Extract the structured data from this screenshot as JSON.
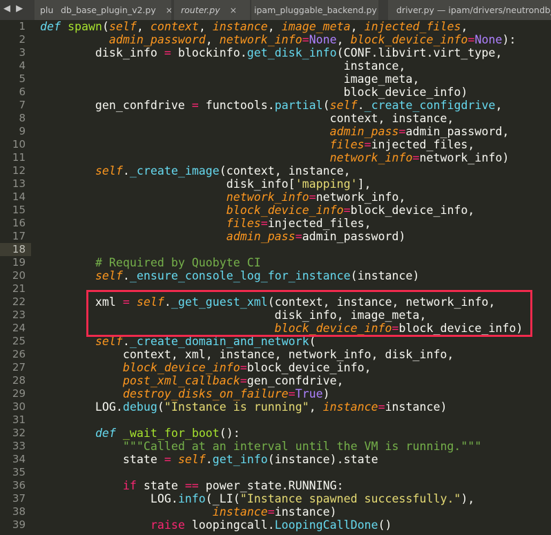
{
  "colors": {
    "background": "#272822",
    "highlight_box": "#ef2a4d",
    "keyword": "#66d9ef",
    "function": "#a6e22e",
    "parameter": "#fd971f",
    "operator": "#f92672",
    "constant": "#ae81ff",
    "string": "#e6db74",
    "comment": "#75b04a"
  },
  "tabs": [
    {
      "label": "plu",
      "close": ""
    },
    {
      "label": "db_base_plugin_v2.py",
      "close": "×"
    },
    {
      "label": "router.py",
      "close": "×"
    },
    {
      "label": "ipam_pluggable_backend.py",
      "close": "●"
    },
    {
      "label": "driver.py — ipam/drivers/neutrondb_ipam",
      "close": ""
    }
  ],
  "nav": "◀ ▶",
  "current_line": 18,
  "highlighted_lines": [
    22,
    24
  ],
  "lines": [
    [
      [
        "kw",
        "def"
      ],
      [
        "pl",
        " "
      ],
      [
        "fn",
        "spawn"
      ],
      [
        "pl",
        "("
      ],
      [
        "pa",
        "self"
      ],
      [
        "pl",
        ", "
      ],
      [
        "pa",
        "context"
      ],
      [
        "pl",
        ", "
      ],
      [
        "pa",
        "instance"
      ],
      [
        "pl",
        ", "
      ],
      [
        "pa",
        "image_meta"
      ],
      [
        "pl",
        ", "
      ],
      [
        "pa",
        "injected_files"
      ],
      [
        "pl",
        ","
      ]
    ],
    [
      [
        "pl",
        "          "
      ],
      [
        "pa",
        "admin_password"
      ],
      [
        "pl",
        ", "
      ],
      [
        "pa",
        "network_info"
      ],
      [
        "op",
        "="
      ],
      [
        "ct",
        "None"
      ],
      [
        "pl",
        ", "
      ],
      [
        "pa",
        "block_device_info"
      ],
      [
        "op",
        "="
      ],
      [
        "ct",
        "None"
      ],
      [
        "pl",
        "):"
      ]
    ],
    [
      [
        "pl",
        "        disk_info "
      ],
      [
        "op",
        "="
      ],
      [
        "pl",
        " blockinfo."
      ],
      [
        "ca",
        "get_disk_info"
      ],
      [
        "pl",
        "(CONF.libvirt.virt_type,"
      ]
    ],
    [
      [
        "pl",
        "                                            instance,"
      ]
    ],
    [
      [
        "pl",
        "                                            image_meta,"
      ]
    ],
    [
      [
        "pl",
        "                                            block_device_info)"
      ]
    ],
    [
      [
        "pl",
        "        gen_confdrive "
      ],
      [
        "op",
        "="
      ],
      [
        "pl",
        " functools."
      ],
      [
        "ca",
        "partial"
      ],
      [
        "pl",
        "("
      ],
      [
        "pa",
        "self"
      ],
      [
        "pl",
        "."
      ],
      [
        "ca",
        "_create_configdrive"
      ],
      [
        "pl",
        ","
      ]
    ],
    [
      [
        "pl",
        "                                          context, instance,"
      ]
    ],
    [
      [
        "pl",
        "                                          "
      ],
      [
        "pa",
        "admin_pass"
      ],
      [
        "op",
        "="
      ],
      [
        "pl",
        "admin_password,"
      ]
    ],
    [
      [
        "pl",
        "                                          "
      ],
      [
        "pa",
        "files"
      ],
      [
        "op",
        "="
      ],
      [
        "pl",
        "injected_files,"
      ]
    ],
    [
      [
        "pl",
        "                                          "
      ],
      [
        "pa",
        "network_info"
      ],
      [
        "op",
        "="
      ],
      [
        "pl",
        "network_info)"
      ]
    ],
    [
      [
        "pl",
        "        "
      ],
      [
        "pa",
        "self"
      ],
      [
        "pl",
        "."
      ],
      [
        "ca",
        "_create_image"
      ],
      [
        "pl",
        "(context, instance,"
      ]
    ],
    [
      [
        "pl",
        "                           disk_info["
      ],
      [
        "st",
        "'mapping'"
      ],
      [
        "pl",
        "],"
      ]
    ],
    [
      [
        "pl",
        "                           "
      ],
      [
        "pa",
        "network_info"
      ],
      [
        "op",
        "="
      ],
      [
        "pl",
        "network_info,"
      ]
    ],
    [
      [
        "pl",
        "                           "
      ],
      [
        "pa",
        "block_device_info"
      ],
      [
        "op",
        "="
      ],
      [
        "pl",
        "block_device_info,"
      ]
    ],
    [
      [
        "pl",
        "                           "
      ],
      [
        "pa",
        "files"
      ],
      [
        "op",
        "="
      ],
      [
        "pl",
        "injected_files,"
      ]
    ],
    [
      [
        "pl",
        "                           "
      ],
      [
        "pa",
        "admin_pass"
      ],
      [
        "op",
        "="
      ],
      [
        "pl",
        "admin_password)"
      ]
    ],
    [],
    [
      [
        "pl",
        "        "
      ],
      [
        "cm",
        "# Required by Quobyte CI"
      ]
    ],
    [
      [
        "pl",
        "        "
      ],
      [
        "pa",
        "self"
      ],
      [
        "pl",
        "."
      ],
      [
        "ca",
        "_ensure_console_log_for_instance"
      ],
      [
        "pl",
        "(instance)"
      ]
    ],
    [],
    [
      [
        "pl",
        "        xml "
      ],
      [
        "op",
        "="
      ],
      [
        "pl",
        " "
      ],
      [
        "pa",
        "self"
      ],
      [
        "pl",
        "."
      ],
      [
        "ca",
        "_get_guest_xml"
      ],
      [
        "pl",
        "(context, instance, network_info,"
      ]
    ],
    [
      [
        "pl",
        "                                  disk_info, image_meta,"
      ]
    ],
    [
      [
        "pl",
        "                                  "
      ],
      [
        "pa",
        "block_device_info"
      ],
      [
        "op",
        "="
      ],
      [
        "pl",
        "block_device_info)"
      ]
    ],
    [
      [
        "pl",
        "        "
      ],
      [
        "pa",
        "self"
      ],
      [
        "pl",
        "."
      ],
      [
        "ca",
        "_create_domain_and_network"
      ],
      [
        "pl",
        "("
      ]
    ],
    [
      [
        "pl",
        "            context, xml, instance, network_info, disk_info,"
      ]
    ],
    [
      [
        "pl",
        "            "
      ],
      [
        "pa",
        "block_device_info"
      ],
      [
        "op",
        "="
      ],
      [
        "pl",
        "block_device_info,"
      ]
    ],
    [
      [
        "pl",
        "            "
      ],
      [
        "pa",
        "post_xml_callback"
      ],
      [
        "op",
        "="
      ],
      [
        "pl",
        "gen_confdrive,"
      ]
    ],
    [
      [
        "pl",
        "            "
      ],
      [
        "pa",
        "destroy_disks_on_failure"
      ],
      [
        "op",
        "="
      ],
      [
        "ct",
        "True"
      ],
      [
        "pl",
        ")"
      ]
    ],
    [
      [
        "pl",
        "        LOG."
      ],
      [
        "ca",
        "debug"
      ],
      [
        "pl",
        "("
      ],
      [
        "st",
        "\"Instance is running\""
      ],
      [
        "pl",
        ", "
      ],
      [
        "pa",
        "instance"
      ],
      [
        "op",
        "="
      ],
      [
        "pl",
        "instance)"
      ]
    ],
    [],
    [
      [
        "pl",
        "        "
      ],
      [
        "kw",
        "def"
      ],
      [
        "pl",
        " "
      ],
      [
        "fn",
        "_wait_for_boot"
      ],
      [
        "pl",
        "():"
      ]
    ],
    [
      [
        "pl",
        "            "
      ],
      [
        "cm",
        "\"\"\"Called at an interval until the VM is running.\"\"\""
      ]
    ],
    [
      [
        "pl",
        "            state "
      ],
      [
        "op",
        "="
      ],
      [
        "pl",
        " "
      ],
      [
        "pa",
        "self"
      ],
      [
        "pl",
        "."
      ],
      [
        "ca",
        "get_info"
      ],
      [
        "pl",
        "(instance).state"
      ]
    ],
    [],
    [
      [
        "pl",
        "            "
      ],
      [
        "op",
        "if"
      ],
      [
        "pl",
        " state "
      ],
      [
        "op",
        "=="
      ],
      [
        "pl",
        " power_state.RUNNING:"
      ]
    ],
    [
      [
        "pl",
        "                LOG."
      ],
      [
        "ca",
        "info"
      ],
      [
        "pl",
        "(_LI("
      ],
      [
        "st",
        "\"Instance spawned successfully.\""
      ],
      [
        "pl",
        "),"
      ]
    ],
    [
      [
        "pl",
        "                         "
      ],
      [
        "pa",
        "instance"
      ],
      [
        "op",
        "="
      ],
      [
        "pl",
        "instance)"
      ]
    ],
    [
      [
        "pl",
        "                "
      ],
      [
        "op",
        "raise"
      ],
      [
        "pl",
        " loopingcall."
      ],
      [
        "ca",
        "LoopingCallDone"
      ],
      [
        "pl",
        "()"
      ]
    ]
  ]
}
